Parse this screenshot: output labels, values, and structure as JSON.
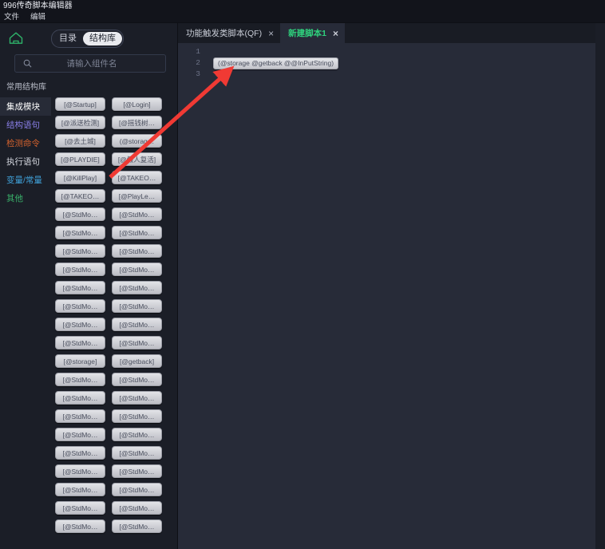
{
  "window": {
    "title": "996传奇脚本编辑器"
  },
  "menubar": {
    "items": [
      {
        "label": "文件",
        "name": "menu-file"
      },
      {
        "label": "编辑",
        "name": "menu-edit"
      }
    ]
  },
  "left_panel": {
    "home_icon": "home-icon",
    "toggle": {
      "options": [
        "目录",
        "结构库"
      ],
      "selected": "结构库"
    },
    "search": {
      "icon": "search-icon",
      "value": "",
      "placeholder": "请输入组件名"
    },
    "section_title": "常用结构库",
    "categories": [
      {
        "label": "集成模块",
        "color": "#ffffff",
        "active": true
      },
      {
        "label": "结构语句",
        "color": "#8a7fe8",
        "active": false
      },
      {
        "label": "检测命令",
        "color": "#d4622e",
        "active": false
      },
      {
        "label": "执行语句",
        "color": "#d7dae2",
        "active": false
      },
      {
        "label": "变量/常量",
        "color": "#3f9fd6",
        "active": false
      },
      {
        "label": "其他",
        "color": "#39b06a",
        "active": false
      }
    ],
    "components": [
      "[@Startup]",
      "[@Login]",
      "[@派送检测]",
      "[@摇钱树…",
      "[@去土城]",
      "(@storag…",
      "[@PLAYDIE]",
      "[@假人复活]",
      "[@KillPlay]",
      "[@TAKEO…",
      "[@TAKEO…",
      "[@PlayLe…",
      "[@StdMo…",
      "[@StdMo…",
      "[@StdMo…",
      "[@StdMo…",
      "[@StdMo…",
      "[@StdMo…",
      "[@StdMo…",
      "[@StdMo…",
      "[@StdMo…",
      "[@StdMo…",
      "[@StdMo…",
      "[@StdMo…",
      "[@StdMo…",
      "[@StdMo…",
      "[@StdMo…",
      "[@StdMo…",
      "[@storage]",
      "[@getback]",
      "[@StdMo…",
      "[@StdMo…",
      "[@StdMo…",
      "[@StdMo…",
      "[@StdMo…",
      "[@StdMo…",
      "[@StdMo…",
      "[@StdMo…",
      "[@StdMo…",
      "[@StdMo…",
      "[@StdMo…",
      "[@StdMo…",
      "[@StdMo…",
      "[@StdMo…",
      "[@StdMo…",
      "[@StdMo…",
      "[@StdMo…",
      "[@StdMo…"
    ]
  },
  "editor": {
    "tabs": [
      {
        "label": "功能触发类脚本(QF)",
        "active": false,
        "close": "×"
      },
      {
        "label": "新建脚本1",
        "active": true,
        "close": "×"
      }
    ],
    "line_numbers": [
      "1",
      "2",
      "3"
    ],
    "lines": [
      "",
      "(@storage @getback @@InPutString)",
      ""
    ]
  },
  "annotation": {
    "arrow_color": "#f03a34",
    "from": [
      138,
      222
    ],
    "to": [
      287,
      88
    ]
  }
}
